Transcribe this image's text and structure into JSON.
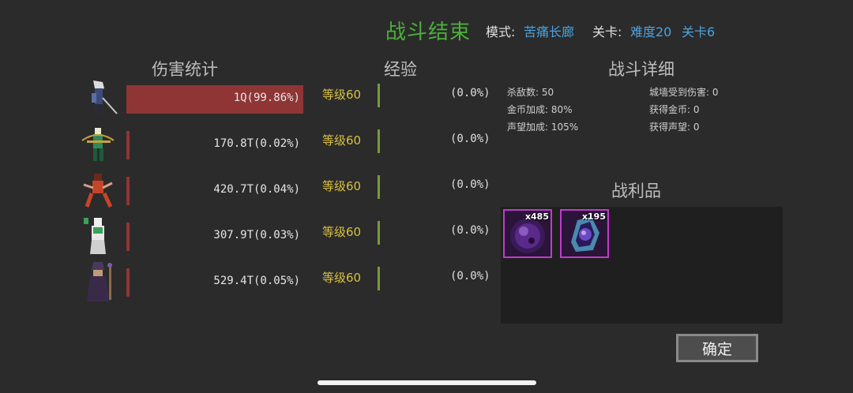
{
  "header": {
    "title": "战斗结束",
    "mode_label": "模式:",
    "mode_value": "苦痛长廊",
    "level_label": "关卡:",
    "difficulty": "难度20",
    "stage": "关卡6"
  },
  "sections": {
    "damage": "伤害统计",
    "exp": "经验",
    "details": "战斗详细",
    "loot": "战利品"
  },
  "heroes": [
    {
      "damage": "1Q(99.86%)",
      "share": 0.9986,
      "level": "等级60",
      "exp": "(0.0%)",
      "exp_fill": 0.0
    },
    {
      "damage": "170.8T(0.02%)",
      "share": 0.0002,
      "level": "等级60",
      "exp": "(0.0%)",
      "exp_fill": 0.0
    },
    {
      "damage": "420.7T(0.04%)",
      "share": 0.0004,
      "level": "等级60",
      "exp": "(0.0%)",
      "exp_fill": 0.0
    },
    {
      "damage": "307.9T(0.03%)",
      "share": 0.0003,
      "level": "等级60",
      "exp": "(0.0%)",
      "exp_fill": 0.0
    },
    {
      "damage": "529.4T(0.05%)",
      "share": 0.0005,
      "level": "等级60",
      "exp": "(0.0%)",
      "exp_fill": 0.0
    }
  ],
  "details": {
    "kills": "杀敌数: 50",
    "gold_bonus": "金币加成: 80%",
    "fame_bonus": "声望加成: 105%",
    "wall_damage": "城墙受到伤害: 0",
    "gold_earned": "获得金币: 0",
    "fame_earned": "获得声望: 0"
  },
  "loot": [
    {
      "count": "x485",
      "icon": "dark-orb-icon"
    },
    {
      "count": "x195",
      "icon": "crystal-shard-icon"
    }
  ],
  "confirm_label": "确定",
  "colors": {
    "title": "#4caf3a",
    "accent": "#4aa3e0",
    "damage_bar": "#8f3535",
    "level": "#d8c040",
    "loot_border": "#c23ad0"
  }
}
